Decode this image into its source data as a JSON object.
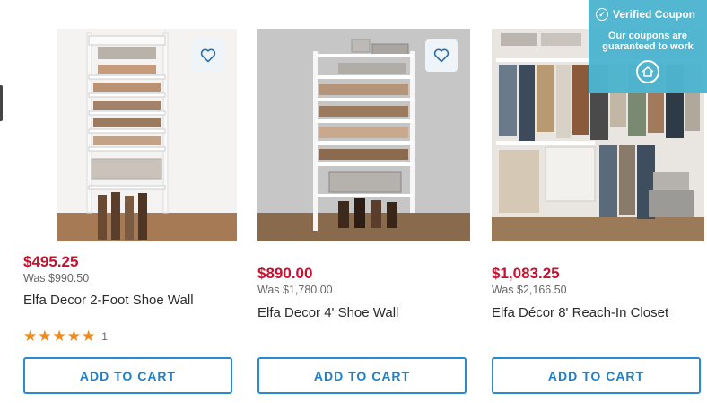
{
  "products": [
    {
      "price": "$495.25",
      "was": "Was $990.50",
      "name": "Elfa Decor 2-Foot Shoe Wall",
      "rating": {
        "stars": 5,
        "count": "1"
      },
      "button": "ADD TO CART"
    },
    {
      "price": "$890.00",
      "was": "Was $1,780.00",
      "name": "Elfa Decor 4' Shoe Wall",
      "button": "ADD TO CART"
    },
    {
      "price": "$1,083.25",
      "was": "Was $2,166.50",
      "name": "Elfa Décor 8' Reach-In Closet",
      "button": "ADD TO CART"
    }
  ],
  "coupon": {
    "title": "Verified Coupon",
    "text": "Our coupons are guaranteed to work"
  },
  "colors": {
    "price": "#c8102e",
    "button_border": "#2a8ad0",
    "star": "#f08a1c",
    "coupon_bg": "#4fb5d0"
  },
  "icons": [
    "heart-icon",
    "star-icon",
    "check-circle-icon",
    "home-icon"
  ]
}
